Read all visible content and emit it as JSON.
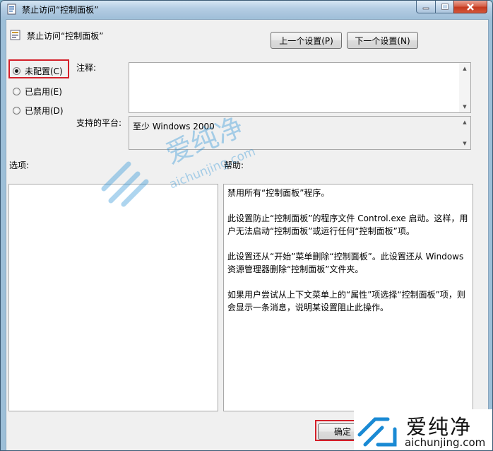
{
  "window": {
    "title": "禁止访问“控制面板”"
  },
  "header": {
    "policy_name": "禁止访问“控制面板”",
    "prev_button": "上一个设置(P)",
    "next_button": "下一个设置(N)"
  },
  "state_options": [
    {
      "label": "未配置(C)",
      "checked": true
    },
    {
      "label": "已启用(E)",
      "checked": false
    },
    {
      "label": "已禁用(D)",
      "checked": false
    }
  ],
  "comment": {
    "label": "注释:",
    "value": ""
  },
  "platform": {
    "label": "支持的平台:",
    "value": "至少 Windows 2000"
  },
  "options_label": "选项:",
  "help": {
    "label": "帮助:",
    "paragraphs": [
      "禁用所有“控制面板”程序。",
      "此设置防止“控制面板”的程序文件 Control.exe 启动。这样，用户无法启动“控制面板”或运行任何“控制面板”项。",
      "此设置还从“开始”菜单删除“控制面板”。此设置还从 Windows 资源管理器删除“控制面板”文件夹。",
      "如果用户尝试从上下文菜单上的“属性”项选择“控制面板”项，则会显示一条消息，说明某设置阻止此操作。"
    ]
  },
  "footer": {
    "ok_button": "确定"
  },
  "watermark": {
    "brand": "爱纯净",
    "domain": "aichunjing.com"
  },
  "colors": {
    "highlight": "#d4202a",
    "watermark": "#1a8ad4"
  }
}
